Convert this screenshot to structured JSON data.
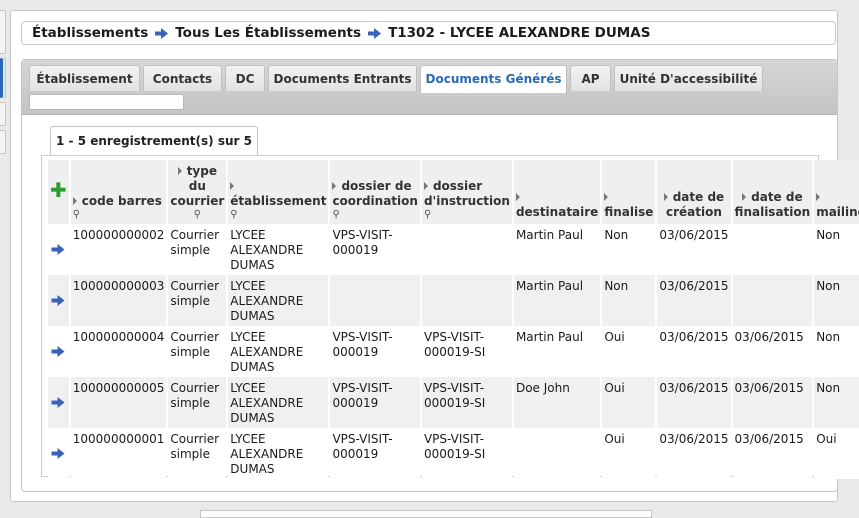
{
  "breadcrumb": {
    "items": [
      "Établissements",
      "Tous Les Établissements",
      "T1302 - LYCEE ALEXANDRE DUMAS"
    ]
  },
  "tabs": [
    {
      "label": "Établissement",
      "active": false
    },
    {
      "label": "Contacts",
      "active": false
    },
    {
      "label": "DC",
      "active": false
    },
    {
      "label": "Documents Entrants",
      "active": false
    },
    {
      "label": "Documents Générés",
      "active": true
    },
    {
      "label": "AP",
      "active": false
    },
    {
      "label": "Unité D'accessibilité",
      "active": false
    }
  ],
  "tab_search": {
    "value": "",
    "placeholder": ""
  },
  "record_count": "1 - 5 enregistrement(s) sur 5",
  "table": {
    "columns": [
      {
        "label": "code barres",
        "sortable": true,
        "searchable": true
      },
      {
        "label": "type du courrier",
        "sortable": true,
        "searchable": true
      },
      {
        "label": "établissement",
        "sortable": true,
        "searchable": true
      },
      {
        "label": "dossier de coordination",
        "sortable": true,
        "searchable": true
      },
      {
        "label": "dossier d'instruction",
        "sortable": true,
        "searchable": true
      },
      {
        "label": "destinataire",
        "sortable": true,
        "searchable": false
      },
      {
        "label": "finalise",
        "sortable": true,
        "searchable": false
      },
      {
        "label": "date de création",
        "sortable": true,
        "searchable": false
      },
      {
        "label": "date de finalisation",
        "sortable": true,
        "searchable": false
      },
      {
        "label": "mailing",
        "sortable": true,
        "searchable": false
      }
    ],
    "rows": [
      [
        "100000000002",
        "Courrier simple",
        "LYCEE ALEXANDRE DUMAS",
        "VPS-VISIT-000019",
        "",
        "Martin Paul",
        "Non",
        "03/06/2015",
        "",
        "Non"
      ],
      [
        "100000000003",
        "Courrier simple",
        "LYCEE ALEXANDRE DUMAS",
        "",
        "",
        "Martin Paul",
        "Non",
        "03/06/2015",
        "",
        "Non"
      ],
      [
        "100000000004",
        "Courrier simple",
        "LYCEE ALEXANDRE DUMAS",
        "VPS-VISIT-000019",
        "VPS-VISIT-000019-SI",
        "Martin Paul",
        "Oui",
        "03/06/2015",
        "03/06/2015",
        "Non"
      ],
      [
        "100000000005",
        "Courrier simple",
        "LYCEE ALEXANDRE DUMAS",
        "VPS-VISIT-000019",
        "VPS-VISIT-000019-SI",
        "Doe John",
        "Oui",
        "03/06/2015",
        "03/06/2015",
        "Non"
      ],
      [
        "100000000001",
        "Courrier simple",
        "LYCEE ALEXANDRE DUMAS",
        "VPS-VISIT-000019",
        "VPS-VISIT-000019-SI",
        "",
        "Oui",
        "03/06/2015",
        "03/06/2015",
        "Oui"
      ]
    ]
  },
  "icons": {
    "add": "plus-icon",
    "row_action": "arrow-right-icon",
    "breadcrumb_sep": "arrow-right-icon",
    "search": "magnifier-icon"
  },
  "colors": {
    "accent": "#2a6ab4",
    "add_green": "#2e9a2e",
    "arrow_blue": "#3a62b8"
  }
}
